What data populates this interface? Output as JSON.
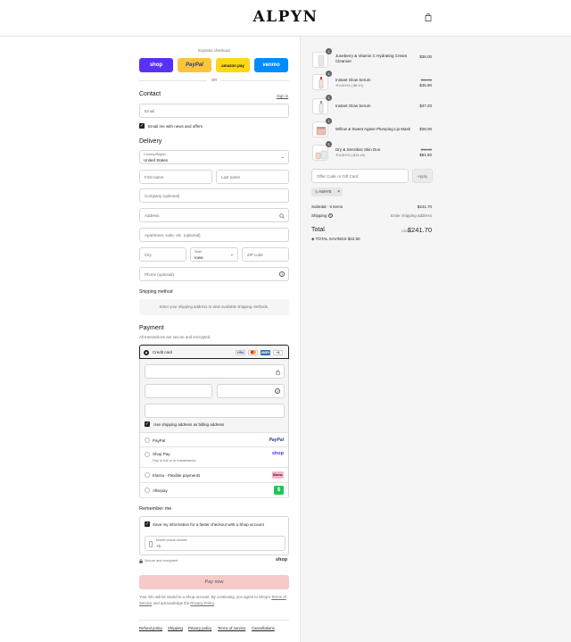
{
  "header": {
    "logo": "ALPYN"
  },
  "express": {
    "title": "Express checkout",
    "buttons": [
      "shop",
      "PayPal",
      "amazon pay",
      "venmo"
    ],
    "or": "OR"
  },
  "contact": {
    "title": "Contact",
    "sign_in": "Sign in",
    "email_placeholder": "Email",
    "news_label": "Email me with news and offers"
  },
  "delivery": {
    "title": "Delivery",
    "country_label": "Country/Region",
    "country_value": "United States",
    "first_name": "First name",
    "last_name": "Last name",
    "company": "Company (optional)",
    "address": "Address",
    "apartment": "Apartment, suite, etc. (optional)",
    "city": "City",
    "state_label": "State",
    "state_value": "Iowa",
    "zip": "ZIP code",
    "phone": "Phone (optional)"
  },
  "shipping": {
    "title": "Shipping method",
    "notice": "Enter your shipping address to view available shipping methods."
  },
  "payment": {
    "title": "Payment",
    "subtitle": "All transactions are secure and encrypted.",
    "credit_card": "Credit card",
    "card_logos": [
      "VISA",
      "MC",
      "AMEX",
      "+4"
    ],
    "billing_label": "Use shipping address as billing address",
    "paypal": "PayPal",
    "shop_pay": "Shop Pay",
    "shop_pay_sub": "Pay in full or in installments",
    "klarna": "Klarna - Flexible payments",
    "afterpay": "Afterpay",
    "paypal_logo": "PayPal",
    "shop_logo": "shop",
    "klarna_logo": "Klarna.",
    "afterpay_logo": "$"
  },
  "remember": {
    "title": "Remember me",
    "save_label": "Save my information for a faster checkout with a Shop account",
    "mobile_label": "Mobile phone number",
    "mobile_value": "+1",
    "secure": "Secure and encrypted",
    "shop": "shop"
  },
  "pay_now": "Pay now",
  "legal": {
    "line1": "Your info will be saved to a Shop account. By continuing, you agree to Shop's",
    "tos": "Terms of Service",
    "and": " and acknowledge the ",
    "privacy": "Privacy Policy",
    "end": "."
  },
  "footer_links": [
    "Refund policy",
    "Shipping",
    "Privacy policy",
    "Terms of service",
    "Cancellations"
  ],
  "order": {
    "items": [
      {
        "qty": "1",
        "name": "Juneberry & Vitamin C Hydrating Cream Cleanser",
        "price": "$38.00",
        "old": "",
        "discount": ""
      },
      {
        "qty": "1",
        "name": "Instant Glow Serum",
        "price": "$45.90",
        "old": "$54.00",
        "discount": "ASHY5 (-$8.10)"
      },
      {
        "qty": "1",
        "name": "Instant Glow Serum",
        "price": "$47.20",
        "old": "",
        "discount": ""
      },
      {
        "qty": "1",
        "name": "Willow & Sweet Agave Plumping Lip Mask",
        "price": "$28.00",
        "old": "",
        "discount": ""
      },
      {
        "qty": "1",
        "name": "Dry & Sensitive Skin Duo",
        "price": "$81.60",
        "old": "$96.00",
        "discount": "ASHY5 (-$14.40)"
      }
    ],
    "discount_placeholder": "Offer Code or Gift Card",
    "apply": "Apply",
    "applied_code": "ASHY5",
    "subtotal_label": "Subtotal · 5 items",
    "subtotal": "$241.70",
    "shipping_label": "Shipping",
    "shipping_value": "Enter shipping address",
    "total_label": "Total",
    "currency": "USD",
    "total": "$241.70",
    "savings_label": "TOTAL SAVINGS",
    "savings": "$22.50"
  },
  "colors": {
    "shop": "#5a31f4",
    "paypal": "#ffc439",
    "amazon": "#ffd814",
    "venmo": "#008cff",
    "pay_now_bg": "#f7c9c9"
  }
}
